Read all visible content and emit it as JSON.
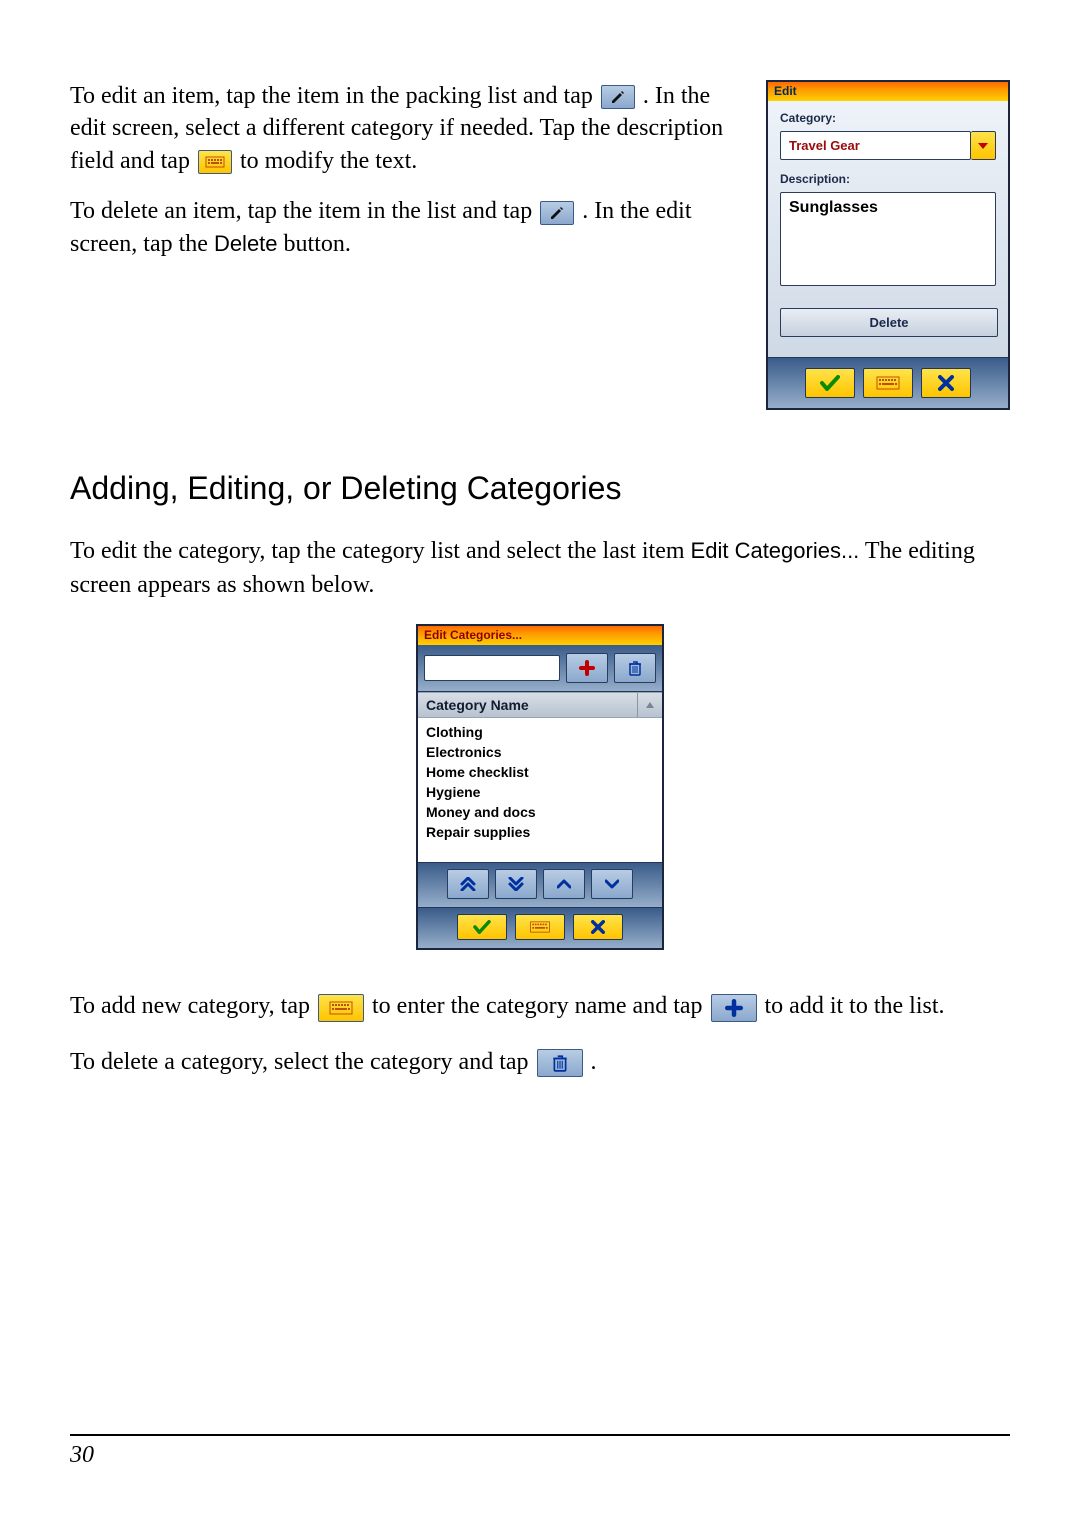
{
  "paragraphs": {
    "editItem_1a": "To edit an item, tap the item in the packing list and tap ",
    "editItem_1b": ". In the edit screen, select a different category if needed. Tap the description field and tap ",
    "editItem_1c": " to modify the text.",
    "deleteItem_1a": "To delete an item, tap the item in the list and tap ",
    "deleteItem_1b": ". In the edit screen, tap the ",
    "deleteItem_1c": " button.",
    "editCategory_1a": "To edit the category, tap the category list and select the last item ",
    "editCategory_1b": " The editing screen appears as shown below.",
    "addCategory_1a": "To add new category, tap ",
    "addCategory_1b": " to enter the category name and tap ",
    "addCategory_1c": " to add it to the list.",
    "deleteCategory_1a": "To delete a category, select the category and tap ",
    "deleteCategory_1b": "."
  },
  "ui_labels": {
    "delete": "Delete",
    "edit_categories": "Edit Categories..."
  },
  "heading": "Adding, Editing, or Deleting Categories",
  "edit_screen": {
    "title": "Edit",
    "category_label": "Category:",
    "category_value": "Travel Gear",
    "description_label": "Description:",
    "description_value": "Sunglasses",
    "delete_button": "Delete"
  },
  "categories_screen": {
    "title": "Edit Categories...",
    "header": "Category Name",
    "items": [
      "Clothing",
      "Electronics",
      "Home checklist",
      "Hygiene",
      "Money and docs",
      "Repair supplies"
    ]
  },
  "page_number": "30"
}
